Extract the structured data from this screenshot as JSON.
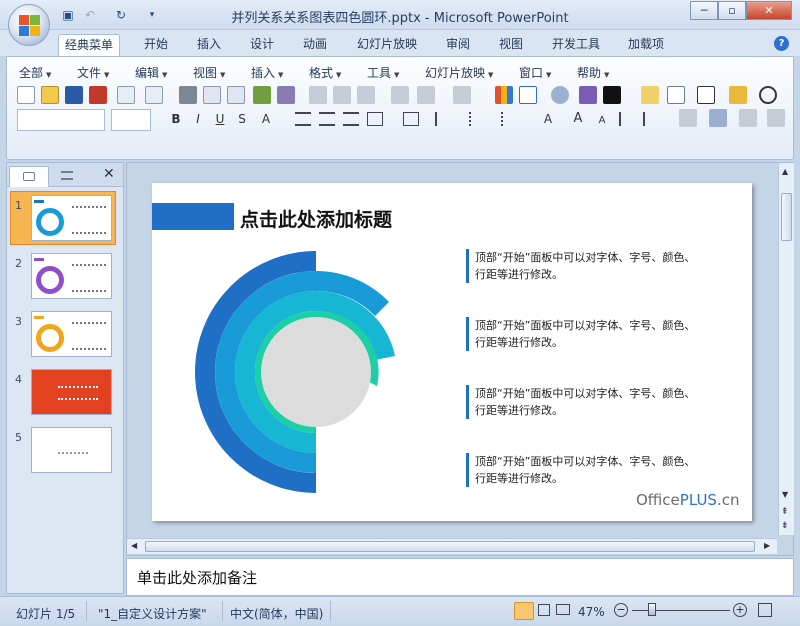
{
  "window": {
    "title": "并列关系关系图表四色圆环.pptx - Microsoft PowerPoint",
    "min_label": "─",
    "restore_label": "▫",
    "close_label": "✕"
  },
  "ribbon_tabs": [
    "经典菜单",
    "开始",
    "插入",
    "设计",
    "动画",
    "幻灯片放映",
    "审阅",
    "视图",
    "开发工具",
    "加载项"
  ],
  "menus": [
    "全部",
    "文件",
    "编辑",
    "视图",
    "插入",
    "格式",
    "工具",
    "幻灯片放映",
    "窗口",
    "帮助"
  ],
  "help_label": "?",
  "slide": {
    "title": "点击此处添加标题",
    "text_line1": "顶部“开始”面板中可以对字体、字号、颜色、",
    "text_line2": "行距等进行修改。",
    "brand_a": "Office",
    "brand_b": "PLUS",
    "brand_c": ".cn",
    "ring_colors": [
      "#1f6fc6",
      "#199bd8",
      "#16b6d4",
      "#1ccfa6"
    ]
  },
  "thumbnails": [
    {
      "num": "1",
      "accent": "#1f6fc6"
    },
    {
      "num": "2",
      "accent": "#8e4fc8"
    },
    {
      "num": "3",
      "accent": "#f2a51a"
    },
    {
      "num": "4",
      "accent": "#e2421f"
    },
    {
      "num": "5",
      "accent": "#ffffff"
    }
  ],
  "notes_placeholder": "单击此处添加备注",
  "status": {
    "slide_count": "幻灯片 1/5",
    "theme": "\"1_自定义设计方案\"",
    "language": "中文(简体，中国)",
    "zoom": "47%"
  }
}
